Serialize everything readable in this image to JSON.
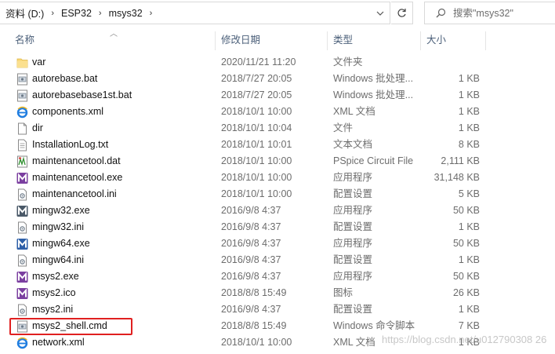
{
  "address": {
    "crumbs": [
      "资料 (D:)",
      "ESP32",
      "msys32"
    ],
    "separator": "›"
  },
  "search": {
    "placeholder": "搜索\"msys32\""
  },
  "columns": {
    "name": "名称",
    "date": "修改日期",
    "type": "类型",
    "size": "大小"
  },
  "highlight_color": "#e02020",
  "files": [
    {
      "name": "var",
      "date": "2020/11/21 11:20",
      "type": "文件夹",
      "size": "",
      "icon": "folder-icon"
    },
    {
      "name": "autorebase.bat",
      "date": "2018/7/27 20:05",
      "type": "Windows 批处理...",
      "size": "1 KB",
      "icon": "batch-file-icon"
    },
    {
      "name": "autorebasebase1st.bat",
      "date": "2018/7/27 20:05",
      "type": "Windows 批处理...",
      "size": "1 KB",
      "icon": "batch-file-icon"
    },
    {
      "name": "components.xml",
      "date": "2018/10/1 10:00",
      "type": "XML 文档",
      "size": "1 KB",
      "icon": "ie-xml-icon"
    },
    {
      "name": "dir",
      "date": "2018/10/1 10:04",
      "type": "文件",
      "size": "1 KB",
      "icon": "blank-file-icon"
    },
    {
      "name": "InstallationLog.txt",
      "date": "2018/10/1 10:01",
      "type": "文本文档",
      "size": "8 KB",
      "icon": "text-file-icon"
    },
    {
      "name": "maintenancetool.dat",
      "date": "2018/10/1 10:00",
      "type": "PSpice Circuit File",
      "size": "2,111 KB",
      "icon": "pspice-file-icon"
    },
    {
      "name": "maintenancetool.exe",
      "date": "2018/10/1 10:00",
      "type": "应用程序",
      "size": "31,148 KB",
      "icon": "msys-purple-icon"
    },
    {
      "name": "maintenancetool.ini",
      "date": "2018/10/1 10:00",
      "type": "配置设置",
      "size": "5 KB",
      "icon": "ini-file-icon"
    },
    {
      "name": "mingw32.exe",
      "date": "2016/9/8 4:37",
      "type": "应用程序",
      "size": "50 KB",
      "icon": "mingw32-icon"
    },
    {
      "name": "mingw32.ini",
      "date": "2016/9/8 4:37",
      "type": "配置设置",
      "size": "1 KB",
      "icon": "ini-file-icon"
    },
    {
      "name": "mingw64.exe",
      "date": "2016/9/8 4:37",
      "type": "应用程序",
      "size": "50 KB",
      "icon": "mingw64-icon"
    },
    {
      "name": "mingw64.ini",
      "date": "2016/9/8 4:37",
      "type": "配置设置",
      "size": "1 KB",
      "icon": "ini-file-icon"
    },
    {
      "name": "msys2.exe",
      "date": "2016/9/8 4:37",
      "type": "应用程序",
      "size": "50 KB",
      "icon": "msys-purple-icon"
    },
    {
      "name": "msys2.ico",
      "date": "2018/8/8 15:49",
      "type": "图标",
      "size": "26 KB",
      "icon": "msys-purple-icon"
    },
    {
      "name": "msys2.ini",
      "date": "2016/9/8 4:37",
      "type": "配置设置",
      "size": "1 KB",
      "icon": "ini-file-icon"
    },
    {
      "name": "msys2_shell.cmd",
      "date": "2018/8/8 15:49",
      "type": "Windows 命令脚本",
      "size": "7 KB",
      "icon": "batch-file-icon"
    },
    {
      "name": "network.xml",
      "date": "2018/10/1 10:00",
      "type": "XML 文档",
      "size": "1 KB",
      "icon": "ie-xml-icon"
    }
  ],
  "watermark": "https://blog.csdn.net/u012790308 26"
}
